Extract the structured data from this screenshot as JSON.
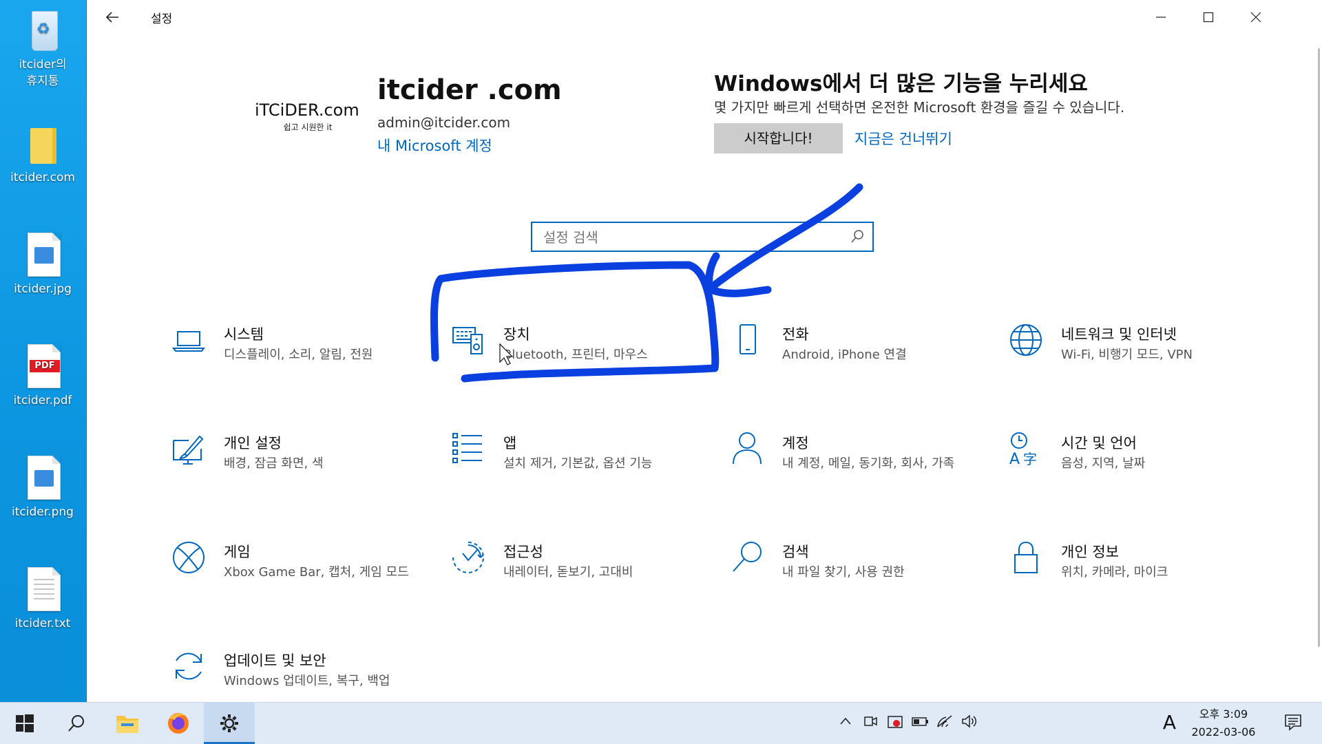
{
  "desktop": {
    "icons": [
      {
        "label_1": "itcider의",
        "label_2": "휴지통",
        "type": "recycle-bin"
      },
      {
        "label": "itcider.com",
        "type": "folder"
      },
      {
        "label": "itcider.jpg",
        "type": "image"
      },
      {
        "label": "itcider.pdf",
        "type": "pdf",
        "badge": "PDF"
      },
      {
        "label": "itcider.png",
        "type": "image"
      },
      {
        "label": "itcider.txt",
        "type": "text"
      }
    ]
  },
  "window": {
    "title": "설정",
    "back_icon": "back-arrow-icon",
    "controls": {
      "minimize": "—",
      "maximize": "☐",
      "close": "✕"
    }
  },
  "account": {
    "logo_text": "iTCiDER.com",
    "logo_tagline": "쉽고 시원한 it",
    "name": "itcider .com",
    "email": "admin@itcider.com",
    "link": "내 Microsoft 계정"
  },
  "promo": {
    "title": "Windows에서 더 많은 기능을 누리세요",
    "description": "몇 가지만 빠르게 선택하면 온전한 Microsoft 환경을 즐길 수 있습니다.",
    "start_button": "시작합니다!",
    "skip_link": "지금은 건너뛰기"
  },
  "search": {
    "placeholder": "설정 검색",
    "value": ""
  },
  "categories": [
    {
      "title": "시스템",
      "desc": "디스플레이, 소리, 알림, 전원",
      "icon": "laptop-icon"
    },
    {
      "title": "장치",
      "desc": "Bluetooth, 프린터, 마우스",
      "icon": "devices-icon"
    },
    {
      "title": "전화",
      "desc": "Android, iPhone 연결",
      "icon": "phone-icon"
    },
    {
      "title": "네트워크 및 인터넷",
      "desc": "Wi-Fi, 비행기 모드, VPN",
      "icon": "globe-icon"
    },
    {
      "title": "개인 설정",
      "desc": "배경, 잠금 화면, 색",
      "icon": "personalization-icon"
    },
    {
      "title": "앱",
      "desc": "설치 제거, 기본값, 옵션 기능",
      "icon": "apps-list-icon"
    },
    {
      "title": "계정",
      "desc": "내 계정, 메일, 동기화, 회사, 가족",
      "icon": "person-icon"
    },
    {
      "title": "시간 및 언어",
      "desc": "음성, 지역, 날짜",
      "icon": "time-language-icon"
    },
    {
      "title": "게임",
      "desc": "Xbox Game Bar, 캡처, 게임 모드",
      "icon": "xbox-icon"
    },
    {
      "title": "접근성",
      "desc": "내레이터, 돋보기, 고대비",
      "icon": "accessibility-icon"
    },
    {
      "title": "검색",
      "desc": "내 파일 찾기, 사용 권한",
      "icon": "search-magnifier-icon"
    },
    {
      "title": "개인 정보",
      "desc": "위치, 카메라, 마이크",
      "icon": "lock-icon"
    },
    {
      "title": "업데이트 및 보안",
      "desc": "Windows 업데이트, 복구, 백업",
      "icon": "update-sync-icon"
    }
  ],
  "colors": {
    "accent": "#0067c0",
    "annotation": "#0a3fe0"
  },
  "taskbar": {
    "apps": [
      "start-icon",
      "search-icon",
      "file-explorer-icon",
      "firefox-icon",
      "settings-gear-icon"
    ],
    "tray": [
      "chevron-up-icon",
      "meet-now-icon",
      "capture-icon",
      "battery-icon",
      "wifi-icon",
      "volume-icon"
    ],
    "ime": "A",
    "time": "오후 3:09",
    "date": "2022-03-06",
    "notification_icon": "notification-icon"
  }
}
